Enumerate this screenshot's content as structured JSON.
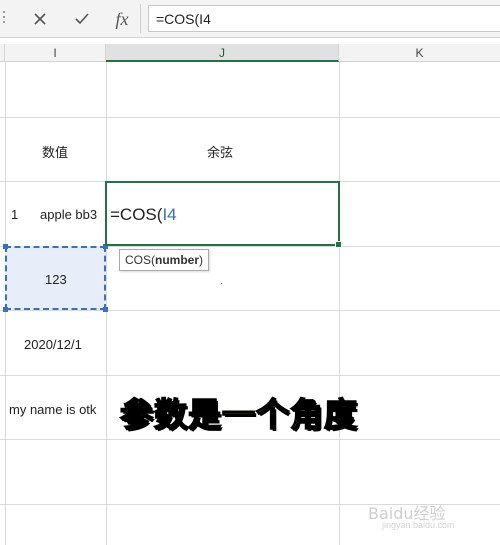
{
  "formula_bar": {
    "cancel_icon": "close-icon",
    "enter_icon": "checkmark-icon",
    "fx_label": "fx",
    "formula": "=COS(I4"
  },
  "columns": [
    {
      "label": "I"
    },
    {
      "label": "J"
    },
    {
      "label": "K"
    }
  ],
  "rows": {
    "header": {
      "col_i": "数值",
      "col_j": "余弦"
    },
    "row1": {
      "num": "1",
      "text": "apple bb3"
    },
    "row2": {
      "value": "123"
    },
    "row3": {
      "value": "2020/12/1"
    },
    "row4": {
      "value": "my name is otk"
    }
  },
  "editing": {
    "prefix": "=COS(",
    "ref": "I4"
  },
  "tooltip": {
    "func": "COS(",
    "arg": "number",
    "close": ")"
  },
  "caption": "参数是一个角度",
  "watermark": {
    "brand": "Baidu经验",
    "url": "jingyan.baidu.com"
  },
  "colors": {
    "selection_green": "#217346",
    "reference_blue": "#3b6fc2",
    "caption_yellow": "#f3e611"
  }
}
